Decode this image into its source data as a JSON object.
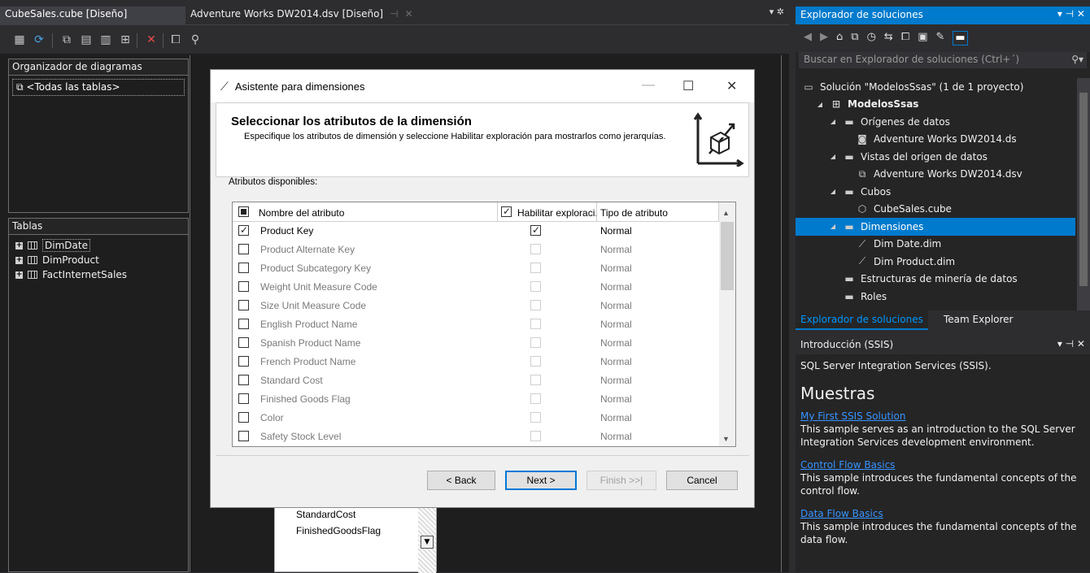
{
  "tabs": {
    "active": "CubeSales.cube [Diseño]",
    "inactive": "Adventure Works DW2014.dsv [Diseño]"
  },
  "diagram_organizer": {
    "title": "Organizador de diagramas",
    "item": "<Todas las tablas>"
  },
  "tables_pane": {
    "title": "Tablas",
    "items": [
      "DimDate",
      "DimProduct",
      "FactInternetSales"
    ]
  },
  "list_fragment": {
    "items": [
      "StandardCost",
      "FinishedGoodsFlag"
    ]
  },
  "dialog": {
    "title": "Asistente para dimensiones",
    "heading": "Seleccionar los atributos de la dimensión",
    "description": "Especifique los atributos de dimensión y seleccione Habilitar exploración para mostrarlos como jerarquías.",
    "available_label": "Atributos disponibles:",
    "columns": {
      "name": "Nombre del atributo",
      "browse": "Habilitar exploraci...",
      "type": "Tipo de atributo"
    },
    "rows": [
      {
        "name": "Product Key",
        "type": "Normal",
        "checked": true
      },
      {
        "name": "Product Alternate Key",
        "type": "Normal",
        "checked": false
      },
      {
        "name": "Product Subcategory Key",
        "type": "Normal",
        "checked": false
      },
      {
        "name": "Weight Unit Measure Code",
        "type": "Normal",
        "checked": false
      },
      {
        "name": "Size Unit Measure Code",
        "type": "Normal",
        "checked": false
      },
      {
        "name": "English Product Name",
        "type": "Normal",
        "checked": false
      },
      {
        "name": "Spanish Product Name",
        "type": "Normal",
        "checked": false
      },
      {
        "name": "French Product Name",
        "type": "Normal",
        "checked": false
      },
      {
        "name": "Standard Cost",
        "type": "Normal",
        "checked": false
      },
      {
        "name": "Finished Goods Flag",
        "type": "Normal",
        "checked": false
      },
      {
        "name": "Color",
        "type": "Normal",
        "checked": false
      },
      {
        "name": "Safety Stock Level",
        "type": "Normal",
        "checked": false
      }
    ],
    "buttons": {
      "back": "< Back",
      "next": "Next >",
      "finish": "Finish >>|",
      "cancel": "Cancel"
    }
  },
  "solution_explorer": {
    "title": "Explorador de soluciones",
    "search_placeholder": "Buscar en Explorador de soluciones (Ctrl+´)",
    "tree": [
      {
        "label": "Solución \"ModelosSsas\" (1 de 1 proyecto)",
        "icon": "solution-icon",
        "level": 0
      },
      {
        "label": "ModelosSsas",
        "icon": "project-icon",
        "level": 1
      },
      {
        "label": "Orígenes de datos",
        "icon": "folder-icon",
        "level": 2
      },
      {
        "label": "Adventure Works DW2014.ds",
        "icon": "database-icon",
        "level": 3
      },
      {
        "label": "Vistas del origen de datos",
        "icon": "folder-icon",
        "level": 2
      },
      {
        "label": "Adventure Works DW2014.dsv",
        "icon": "dsv-icon",
        "level": 3
      },
      {
        "label": "Cubos",
        "icon": "folder-icon",
        "level": 2
      },
      {
        "label": "CubeSales.cube",
        "icon": "cube-icon",
        "level": 3
      },
      {
        "label": "Dimensiones",
        "icon": "folder-icon",
        "level": 2
      },
      {
        "label": "Dim Date.dim",
        "icon": "dimension-icon",
        "level": 3
      },
      {
        "label": "Dim Product.dim",
        "icon": "dimension-icon",
        "level": 3
      },
      {
        "label": "Estructuras de minería de datos",
        "icon": "folder-icon",
        "level": 2
      },
      {
        "label": "Roles",
        "icon": "folder-icon",
        "level": 2
      }
    ],
    "tab_active": "Explorador de soluciones",
    "tab_other": "Team Explorer"
  },
  "ssis": {
    "title": "Introducción (SSIS)",
    "intro": "SQL Server Integration Services (SSIS).",
    "section": "Muestras",
    "samples": [
      {
        "link": "My First SSIS Solution",
        "text": "This sample serves as an introduction to the SQL Server Integration Services development environment."
      },
      {
        "link": "Control Flow Basics",
        "text": "This sample introduces the fundamental concepts of the control flow."
      },
      {
        "link": "Data Flow Basics",
        "text": "This sample introduces the fundamental concepts of the data flow."
      }
    ]
  },
  "colors": {
    "accent": "#007acc",
    "background": "#2d2d30",
    "link": "#3794ff"
  }
}
